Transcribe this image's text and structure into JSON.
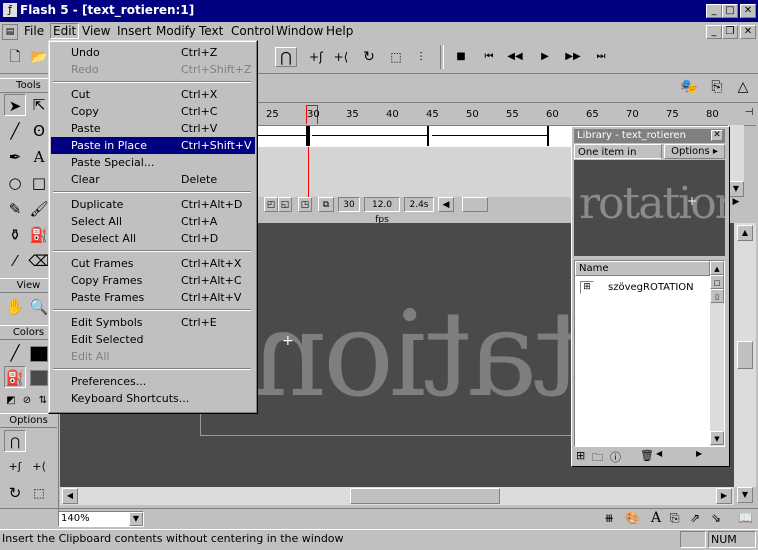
{
  "window": {
    "title": "Flash 5 - [text_rotieren:1]"
  },
  "menubar": [
    "File",
    "Edit",
    "View",
    "Insert",
    "Modify",
    "Text",
    "Control",
    "Window",
    "Help"
  ],
  "edit_menu": {
    "groups": [
      [
        {
          "label": "Undo",
          "shortcut": "Ctrl+Z",
          "disabled": false
        },
        {
          "label": "Redo",
          "shortcut": "Ctrl+Shift+Z",
          "disabled": true
        }
      ],
      [
        {
          "label": "Cut",
          "shortcut": "Ctrl+X",
          "disabled": false
        },
        {
          "label": "Copy",
          "shortcut": "Ctrl+C",
          "disabled": false
        },
        {
          "label": "Paste",
          "shortcut": "Ctrl+V",
          "disabled": false
        },
        {
          "label": "Paste in Place",
          "shortcut": "Ctrl+Shift+V",
          "disabled": false,
          "selected": true
        },
        {
          "label": "Paste Special...",
          "shortcut": "",
          "disabled": false
        },
        {
          "label": "Clear",
          "shortcut": "Delete",
          "disabled": false
        }
      ],
      [
        {
          "label": "Duplicate",
          "shortcut": "Ctrl+Alt+D",
          "disabled": false
        },
        {
          "label": "Select All",
          "shortcut": "Ctrl+A",
          "disabled": false
        },
        {
          "label": "Deselect All",
          "shortcut": "Ctrl+D",
          "disabled": false
        }
      ],
      [
        {
          "label": "Cut Frames",
          "shortcut": "Ctrl+Alt+X",
          "disabled": false
        },
        {
          "label": "Copy Frames",
          "shortcut": "Ctrl+Alt+C",
          "disabled": false
        },
        {
          "label": "Paste Frames",
          "shortcut": "Ctrl+Alt+V",
          "disabled": false
        }
      ],
      [
        {
          "label": "Edit Symbols",
          "shortcut": "Ctrl+E",
          "disabled": false
        },
        {
          "label": "Edit Selected",
          "shortcut": "",
          "disabled": false
        },
        {
          "label": "Edit All",
          "shortcut": "",
          "disabled": true
        }
      ],
      [
        {
          "label": "Preferences...",
          "shortcut": "",
          "disabled": false
        },
        {
          "label": "Keyboard Shortcuts...",
          "shortcut": "",
          "disabled": false
        }
      ]
    ]
  },
  "tools": {
    "tools_header": "Tools",
    "view_header": "View",
    "colors_header": "Colors",
    "options_header": "Options"
  },
  "timeline": {
    "frame_numbers": [
      "25",
      "30",
      "35",
      "40",
      "45",
      "50",
      "55",
      "60",
      "65",
      "70",
      "75",
      "80"
    ],
    "current_frame": "30",
    "fps": "12.0 fps",
    "time": "2.4s"
  },
  "stage": {
    "text": "rotation"
  },
  "library": {
    "title": "Library - text_rotieren",
    "item_count": "One item in librar",
    "options_label": "Options",
    "preview_text": "rotation",
    "column_name": "Name",
    "items": [
      "szövegROTATION"
    ]
  },
  "zoom": {
    "value": "140%"
  },
  "statusbar": {
    "message": "Insert the Clipboard contents without centering in the window",
    "num": "NUM"
  }
}
